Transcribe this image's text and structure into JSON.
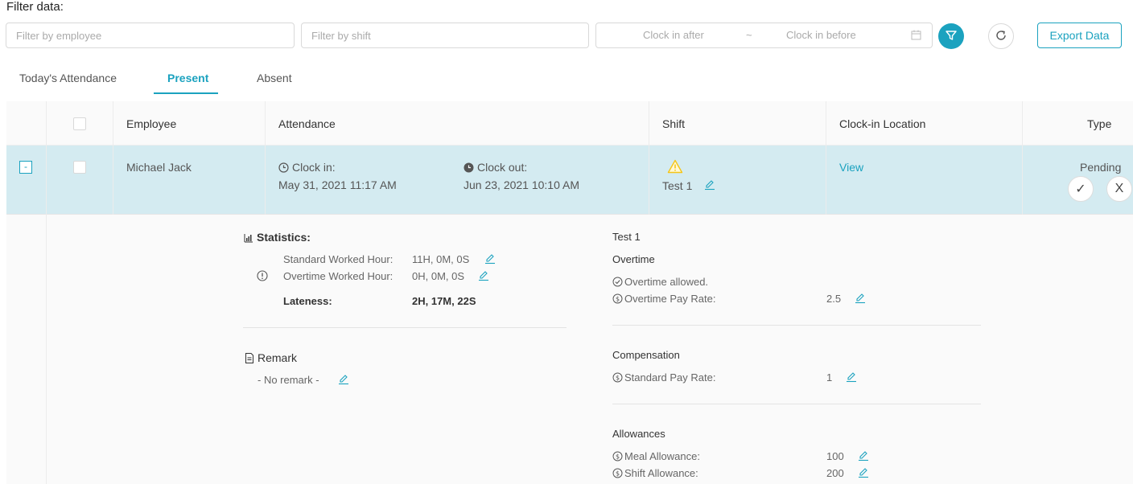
{
  "filter": {
    "title": "Filter data:",
    "employee_placeholder": "Filter by employee",
    "shift_placeholder": "Filter by shift",
    "clock_in_after": "Clock in after",
    "range_sep": "~",
    "clock_in_before": "Clock in before",
    "export_label": "Export Data"
  },
  "tabs": [
    "Today's Attendance",
    "Present",
    "Absent"
  ],
  "active_tab": "Present",
  "table": {
    "headers": {
      "employee": "Employee",
      "attendance": "Attendance",
      "shift": "Shift",
      "location": "Clock-in Location",
      "type": "Type"
    }
  },
  "row": {
    "expand_symbol": "-",
    "employee": "Michael Jack",
    "clock_in_label": "Clock in:",
    "clock_in_value": "May 31, 2021 11:17 AM",
    "clock_out_label": "Clock out:",
    "clock_out_value": "Jun 23, 2021 10:10 AM",
    "shift": "Test 1",
    "location_link": "View",
    "type": "Pending",
    "approve_symbol": "✓",
    "reject_symbol": "X"
  },
  "details": {
    "statistics": {
      "title": "Statistics:",
      "standard_label": "Standard Worked Hour:",
      "standard_value": "11H, 0M, 0S",
      "overtime_label": "Overtime Worked Hour:",
      "overtime_value": "0H, 0M, 0S",
      "lateness_label": "Lateness:",
      "lateness_value": "2H, 17M, 22S"
    },
    "remark": {
      "title": "Remark",
      "value": "- No remark -"
    },
    "shift_name": "Test 1",
    "overtime": {
      "title": "Overtime",
      "allowed": "Overtime allowed.",
      "pay_rate_label": "Overtime Pay Rate:",
      "pay_rate_value": "2.5"
    },
    "compensation": {
      "title": "Compensation",
      "pay_rate_label": "Standard Pay Rate:",
      "pay_rate_value": "1"
    },
    "allowances": {
      "title": "Allowances",
      "meal_label": "Meal Allowance:",
      "meal_value": "100",
      "shift_label": "Shift Allowance:",
      "shift_value": "200"
    }
  },
  "colors": {
    "accent": "#1ba2bf",
    "row_highlight": "#d4ebf1",
    "warning": "#f5c518"
  }
}
